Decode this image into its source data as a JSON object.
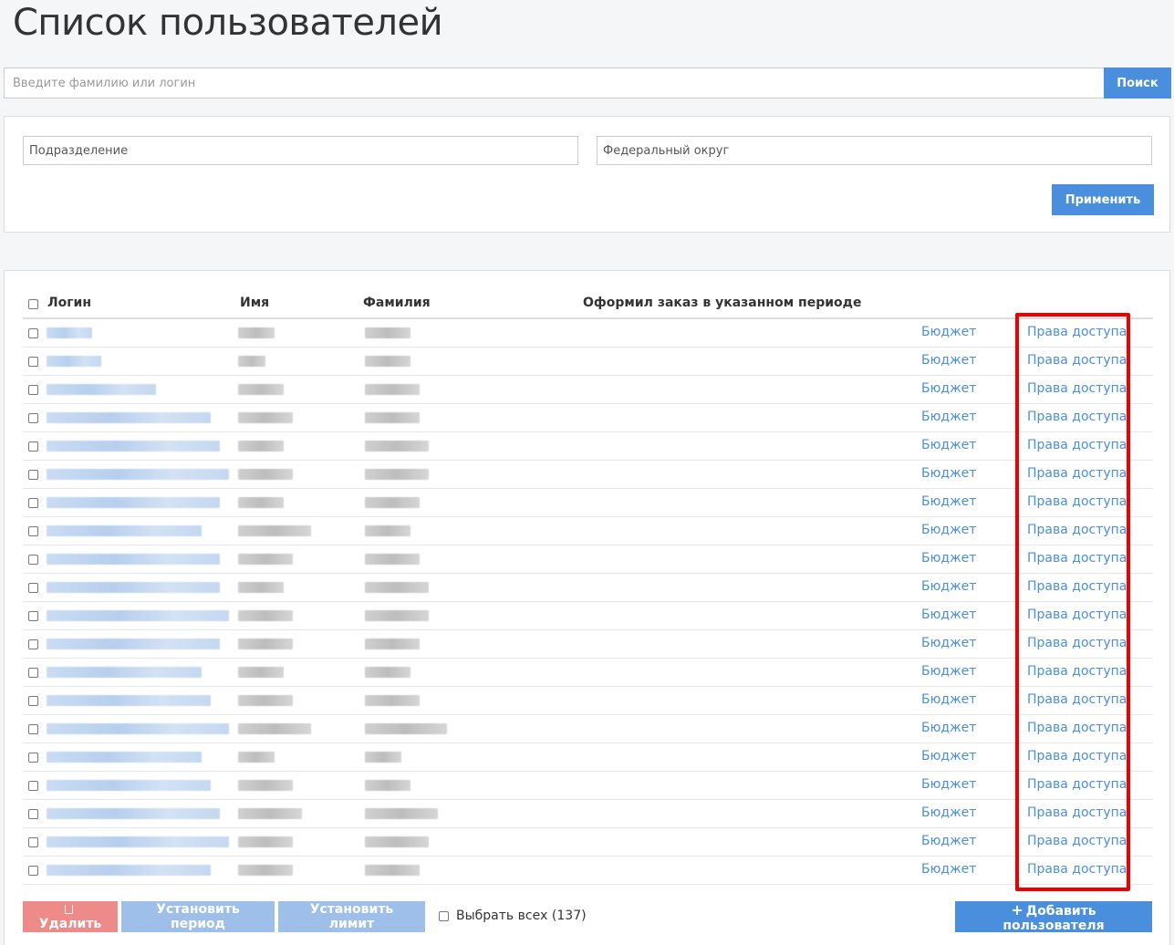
{
  "page": {
    "title": "Список пользователей"
  },
  "search": {
    "placeholder": "Введите фамилию или логин",
    "button": "Поиск"
  },
  "filters": {
    "department_placeholder": "Подразделение",
    "district_placeholder": "Федеральный округ",
    "apply": "Применить"
  },
  "table": {
    "headers": {
      "login": "Логин",
      "name": "Имя",
      "surname": "Фамилия",
      "ordered": "Оформил заказ в указанном периоде"
    },
    "budget_link": "Бюджет",
    "rights_link": "Права доступа"
  },
  "footer": {
    "delete": "Удалить",
    "set_period": "Установить период",
    "set_limit": "Установить лимит",
    "select_all": "Выбрать всех (137)",
    "add_user": "Добавить пользователя"
  },
  "colors": {
    "primary": "#4a8fdd",
    "danger_light": "#ee8a87",
    "primary_light": "#9dbfe9",
    "highlight": "#ee0000"
  }
}
